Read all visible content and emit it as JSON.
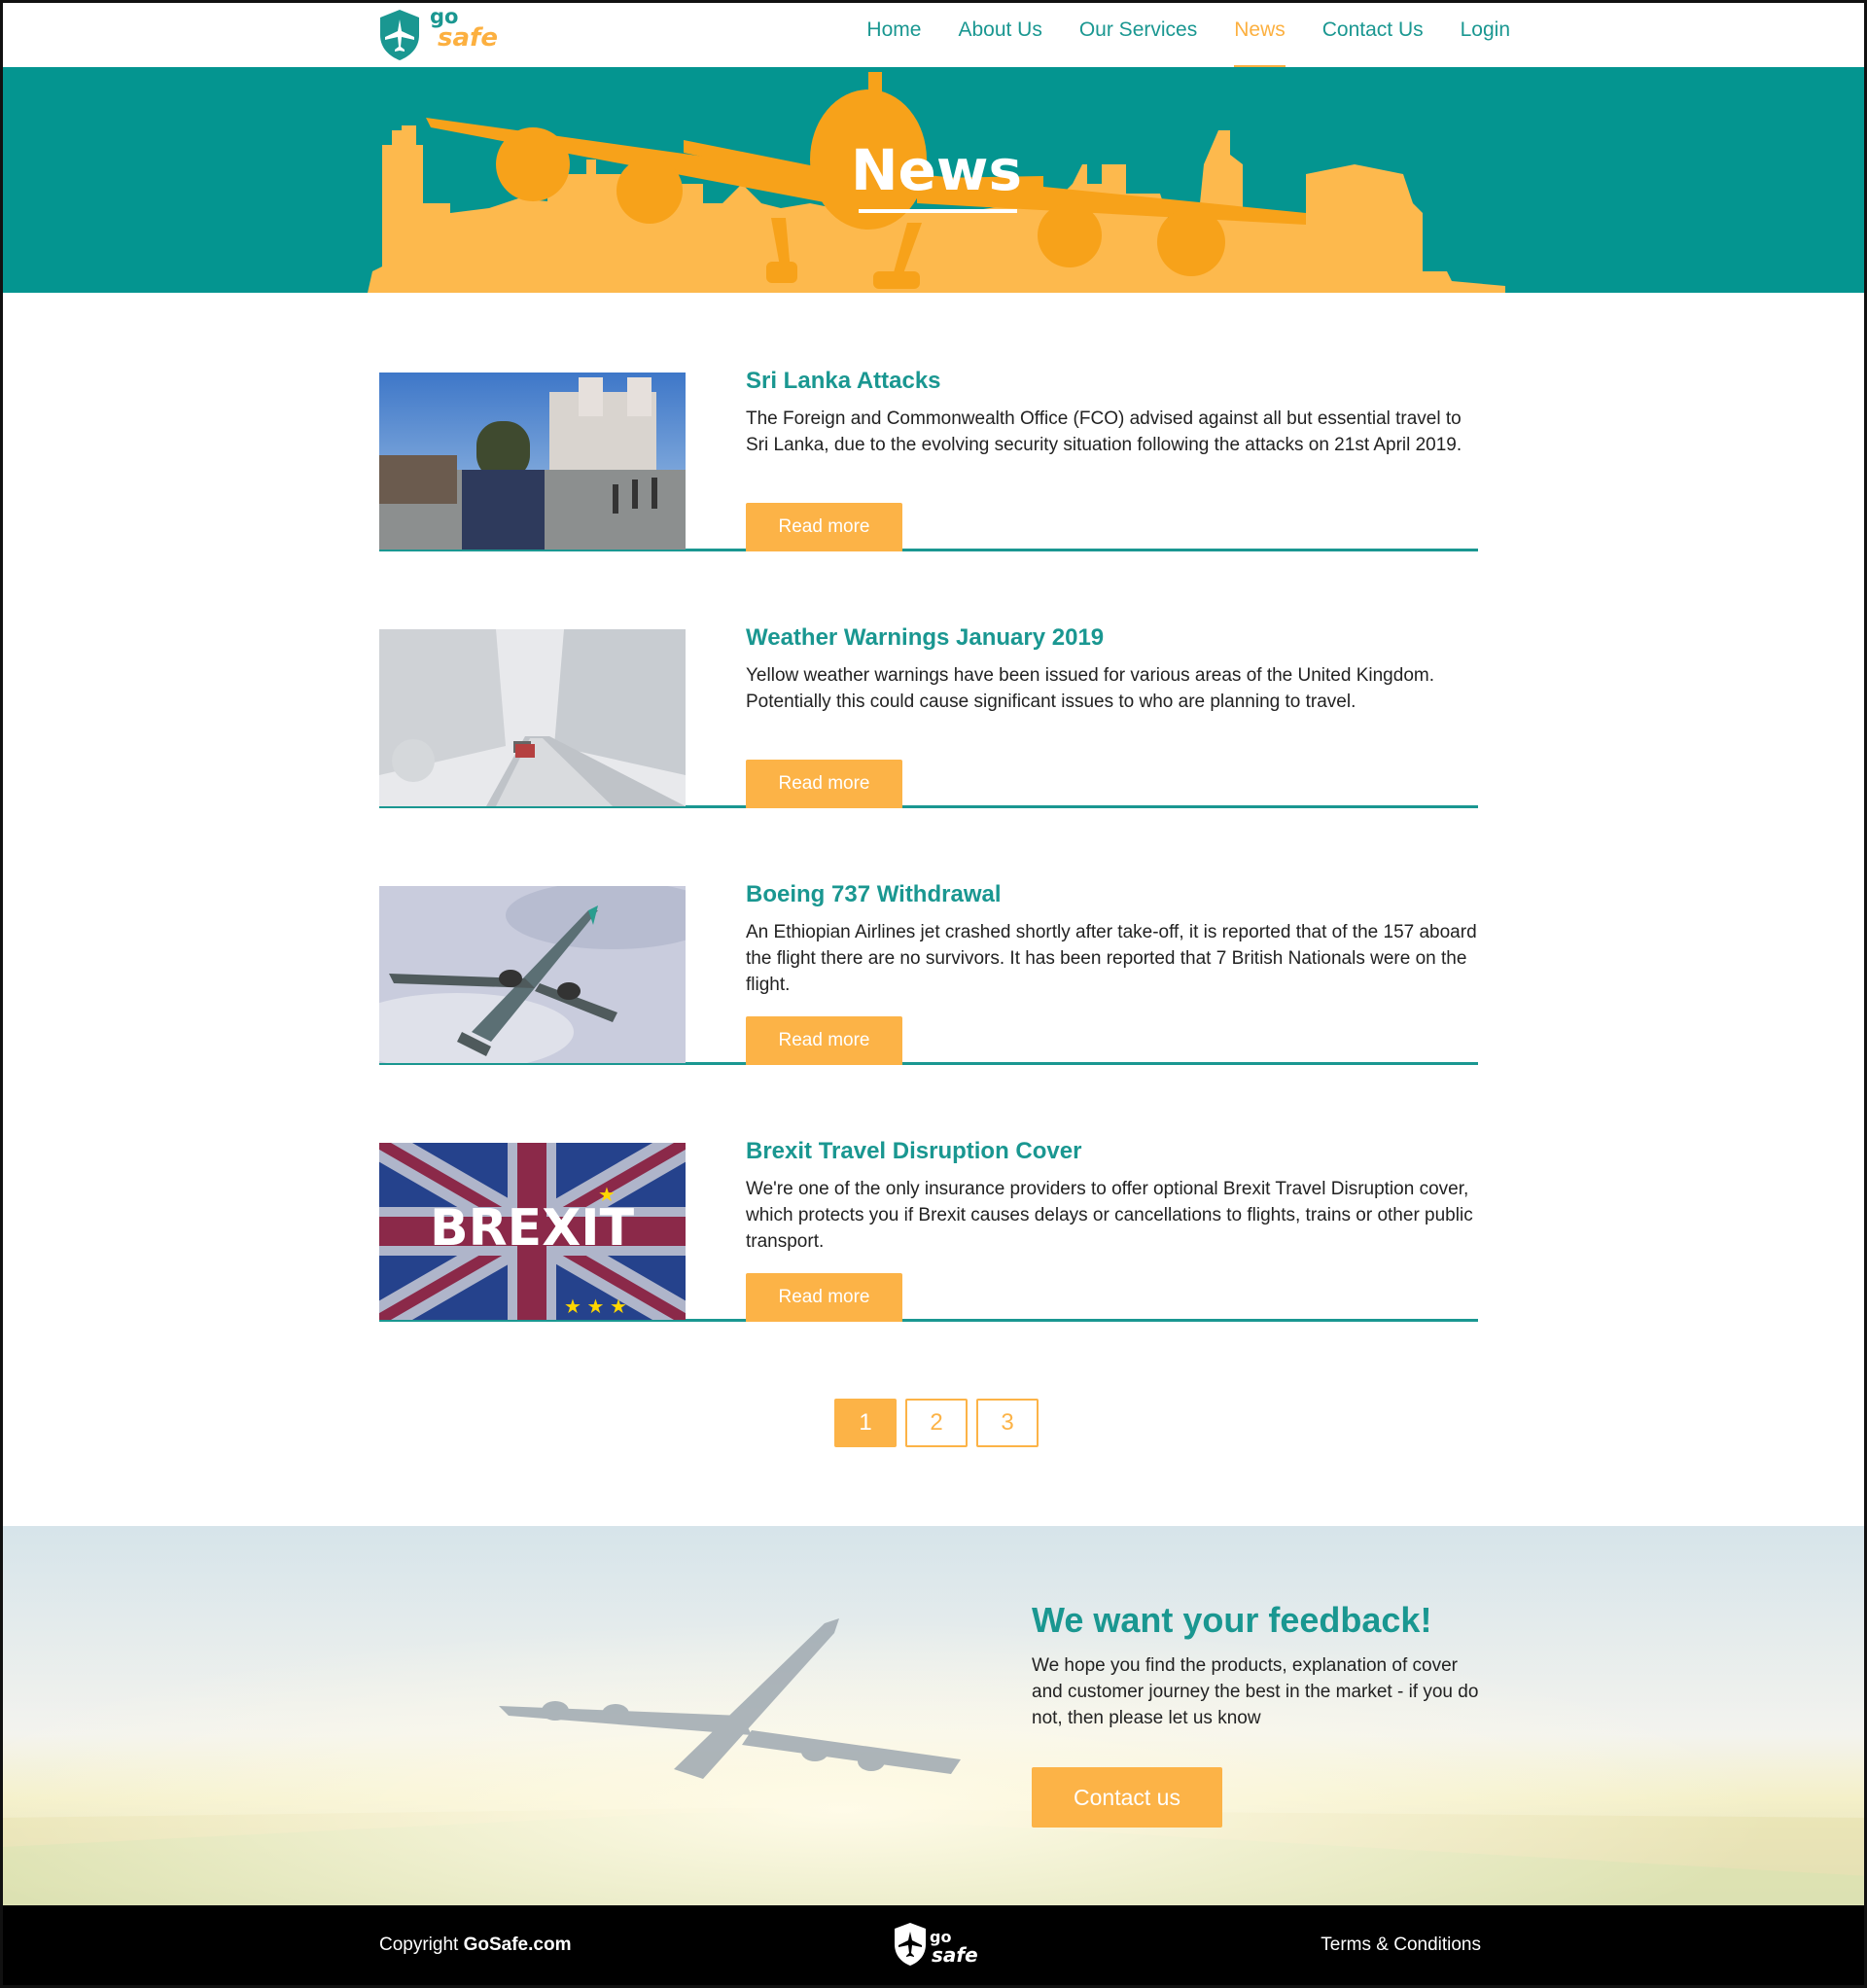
{
  "brand": {
    "logo_go": "go",
    "logo_safe": "safe"
  },
  "nav": {
    "items": [
      {
        "label": "Home"
      },
      {
        "label": "About Us"
      },
      {
        "label": "Our Services"
      },
      {
        "label": "News"
      },
      {
        "label": "Contact Us"
      },
      {
        "label": "Login"
      }
    ],
    "active": "News"
  },
  "hero": {
    "title": "News"
  },
  "articles": [
    {
      "title": "Sri Lanka Attacks",
      "text": "The Foreign and Commonwealth Office (FCO) advised against all but essential travel to Sri Lanka, due to the evolving security situation following the attacks on 21st April 2019.",
      "button": "Read more"
    },
    {
      "title": "Weather Warnings January 2019",
      "text": "Yellow weather warnings have been issued for various areas of the United Kingdom. Potentially this could cause significant issues to who are planning to travel.",
      "button": "Read more"
    },
    {
      "title": "Boeing 737 Withdrawal",
      "text": "An Ethiopian Airlines jet crashed shortly after take-off, it is reported that of the 157 aboard the flight there are no survivors. It has been reported that 7 British Nationals were on the flight.",
      "button": "Read more"
    },
    {
      "title": "Brexit Travel Disruption Cover",
      "text": "We're one of the only insurance providers to offer optional Brexit Travel Disruption cover, which protects you if Brexit causes delays or cancellations to flights, trains or other public transport.",
      "button": "Read more",
      "image_text": "BREXIT"
    }
  ],
  "pagination": {
    "pages": [
      "1",
      "2",
      "3"
    ],
    "current": "1"
  },
  "feedback": {
    "title": "We want your feedback!",
    "text": "We hope you find the products, explanation of cover and customer journey the best in the market - if you do not, then please let us know",
    "button": "Contact us"
  },
  "footer": {
    "copyright_prefix": "Copyright ",
    "copyright_site": "GoSafe.com",
    "terms": "Terms & Conditions"
  },
  "colors": {
    "teal": "#1a9791",
    "orange": "#fcb347",
    "hero_bg": "#049590"
  }
}
